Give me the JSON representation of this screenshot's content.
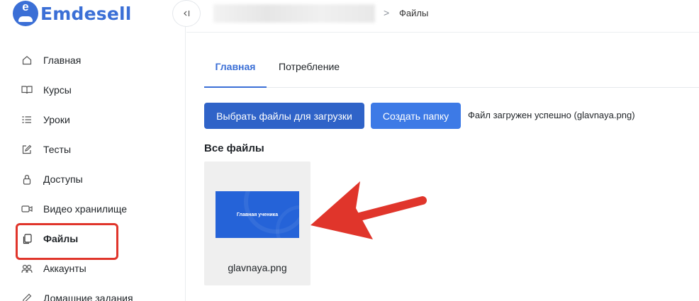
{
  "app": {
    "logo_text": "Emdesell",
    "logo_letter": "e"
  },
  "sidebar": {
    "items": [
      {
        "label": "Главная",
        "icon": "home-icon"
      },
      {
        "label": "Курсы",
        "icon": "book-icon"
      },
      {
        "label": "Уроки",
        "icon": "list-icon"
      },
      {
        "label": "Тесты",
        "icon": "edit-icon"
      },
      {
        "label": "Доступы",
        "icon": "lock-icon"
      },
      {
        "label": "Видео хранилище",
        "icon": "video-icon"
      },
      {
        "label": "Файлы",
        "icon": "file-icon",
        "active": true
      },
      {
        "label": "Аккаунты",
        "icon": "users-icon"
      },
      {
        "label": "Домашние задания",
        "icon": "pencil-icon"
      }
    ]
  },
  "breadcrumb": {
    "separator": ">",
    "current": "Файлы"
  },
  "tabs": [
    {
      "label": "Главная",
      "active": true
    },
    {
      "label": "Потребление"
    }
  ],
  "actions": {
    "upload_label": "Выбрать файлы для загрузки",
    "create_folder_label": "Создать папку"
  },
  "status_message": "Файл загружен успешно (glavnaya.png)",
  "files": {
    "title": "Все файлы",
    "items": [
      {
        "name": "glavnaya.png",
        "thumb_text": "Главная ученика"
      }
    ]
  },
  "colors": {
    "accent": "#3b6fd6",
    "button_primary": "#2f63c8",
    "button_secondary": "#3d7ae6",
    "annotation": "#e0352b"
  }
}
